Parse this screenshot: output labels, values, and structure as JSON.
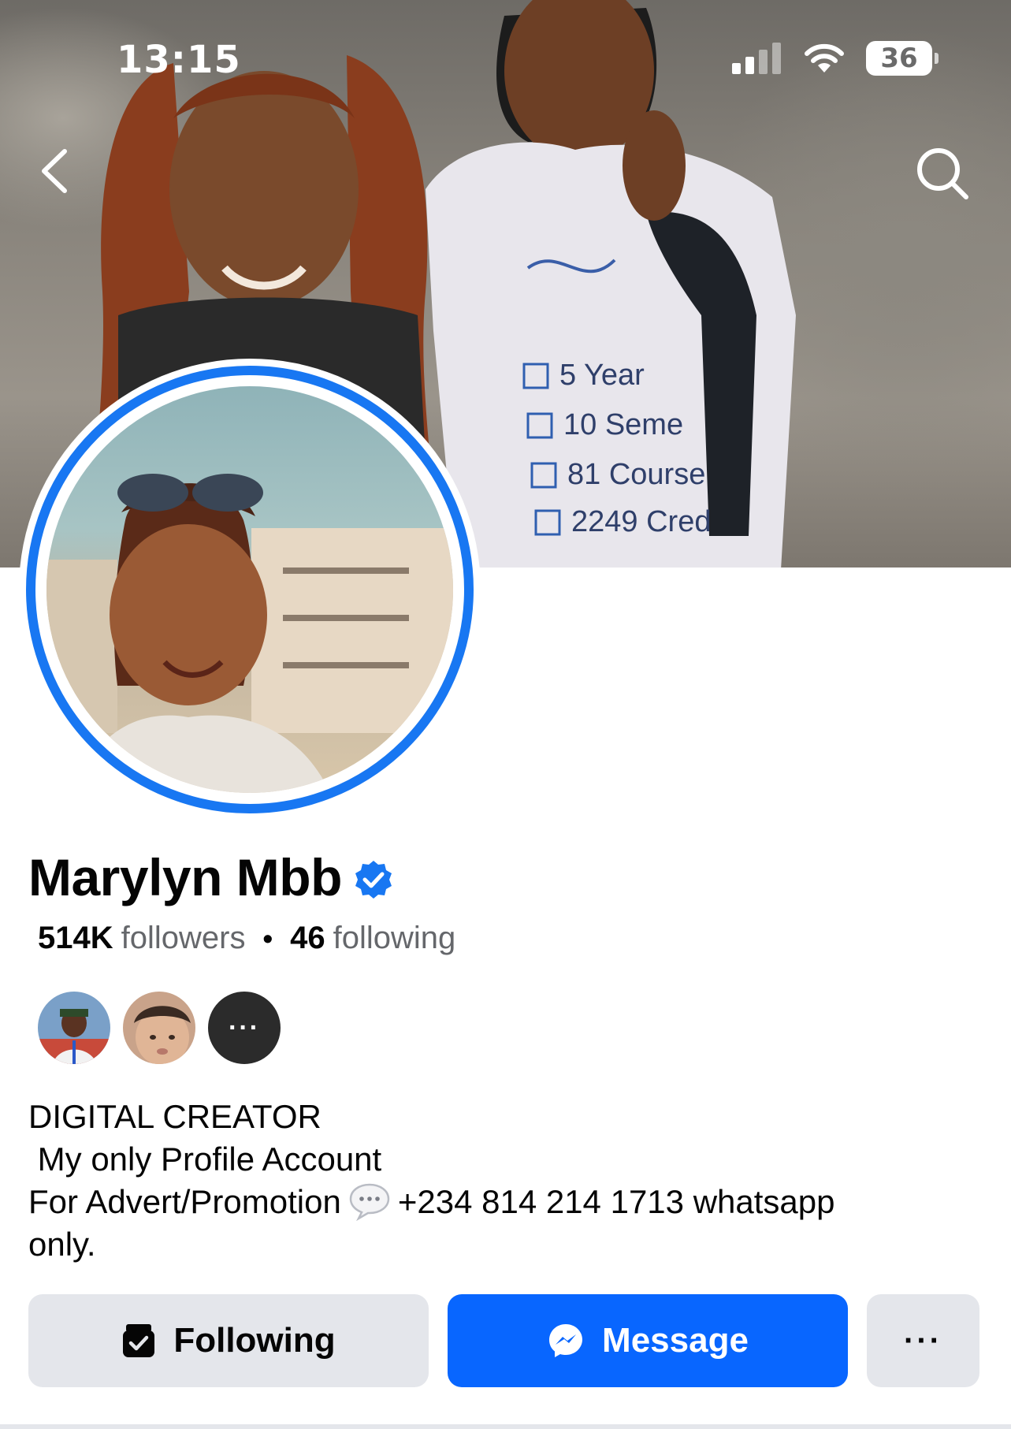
{
  "status_bar": {
    "time": "13:15",
    "battery": "36",
    "icons": [
      "cellular-signal-icon",
      "wifi-icon",
      "battery-icon"
    ]
  },
  "nav": {
    "icons": [
      "back-chevron-icon",
      "search-icon"
    ]
  },
  "profile": {
    "name": "Marylyn Mbb",
    "verified": true,
    "followers_count": "514K",
    "followers_label": "followers",
    "separator": "•",
    "following_count": "46",
    "following_label": "following",
    "mutual_more": "···"
  },
  "bio": {
    "line1": "DIGITAL CREATOR",
    "line2": " My only Profile Account",
    "line3_before": "For Advert/Promotion",
    "line3_after": "+234 814 214 1713 whatsapp",
    "line4": "only."
  },
  "actions": {
    "following_label": "Following",
    "message_label": "Message",
    "more_label": "···"
  },
  "colors": {
    "accent": "#0866ff",
    "verified": "#1877f2",
    "secondary_button": "#e4e6eb",
    "secondary_text": "#65676b"
  }
}
